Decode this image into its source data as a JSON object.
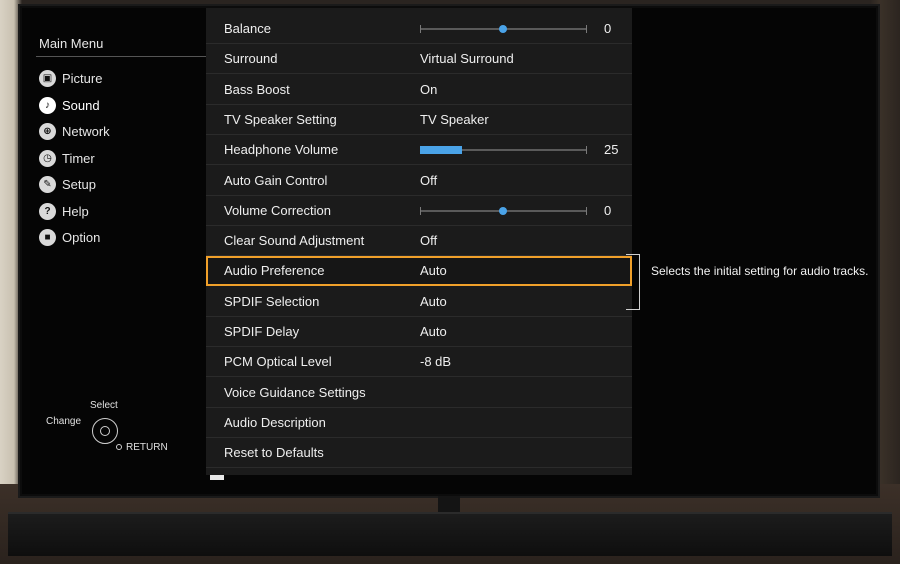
{
  "sidebar": {
    "title": "Main Menu",
    "items": [
      {
        "label": "Picture",
        "icon": "picture-icon",
        "glyph": "▣"
      },
      {
        "label": "Sound",
        "icon": "sound-icon",
        "glyph": "♪"
      },
      {
        "label": "Network",
        "icon": "network-icon",
        "glyph": "⊕"
      },
      {
        "label": "Timer",
        "icon": "timer-icon",
        "glyph": "◷"
      },
      {
        "label": "Setup",
        "icon": "setup-icon",
        "glyph": "✎"
      },
      {
        "label": "Help",
        "icon": "help-icon",
        "glyph": "?"
      },
      {
        "label": "Option",
        "icon": "option-icon",
        "glyph": "■"
      }
    ],
    "active": "Sound"
  },
  "hint": {
    "select": "Select",
    "change": "Change",
    "return": "RETURN"
  },
  "settings": {
    "rows": [
      {
        "label": "Balance",
        "value": "0",
        "type": "slider",
        "level": 0.5
      },
      {
        "label": "Surround",
        "value": "Virtual Surround",
        "type": "text"
      },
      {
        "label": "Bass Boost",
        "value": "On",
        "type": "text"
      },
      {
        "label": "TV Speaker Setting",
        "value": "TV Speaker",
        "type": "text"
      },
      {
        "label": "Headphone Volume",
        "value": "25",
        "type": "fill",
        "level": 0.25
      },
      {
        "label": "Auto Gain Control",
        "value": "Off",
        "type": "text"
      },
      {
        "label": "Volume Correction",
        "value": "0",
        "type": "slider",
        "level": 0.5
      },
      {
        "label": "Clear Sound Adjustment",
        "value": "Off",
        "type": "text"
      },
      {
        "label": "Audio Preference",
        "value": "Auto",
        "type": "text",
        "focused": true
      },
      {
        "label": "SPDIF Selection",
        "value": "Auto",
        "type": "text"
      },
      {
        "label": "SPDIF Delay",
        "value": "Auto",
        "type": "text"
      },
      {
        "label": "PCM Optical Level",
        "value": "-8 dB",
        "type": "text"
      },
      {
        "label": "Voice Guidance Settings",
        "value": "",
        "type": "text"
      },
      {
        "label": "Audio Description",
        "value": "",
        "type": "text"
      },
      {
        "label": "Reset to Defaults",
        "value": "",
        "type": "text"
      }
    ]
  },
  "description": "Selects the initial setting for audio tracks.",
  "colors": {
    "accent": "#4aa3e8",
    "focus": "#f0a02a",
    "panel": "#1b1b1b"
  }
}
